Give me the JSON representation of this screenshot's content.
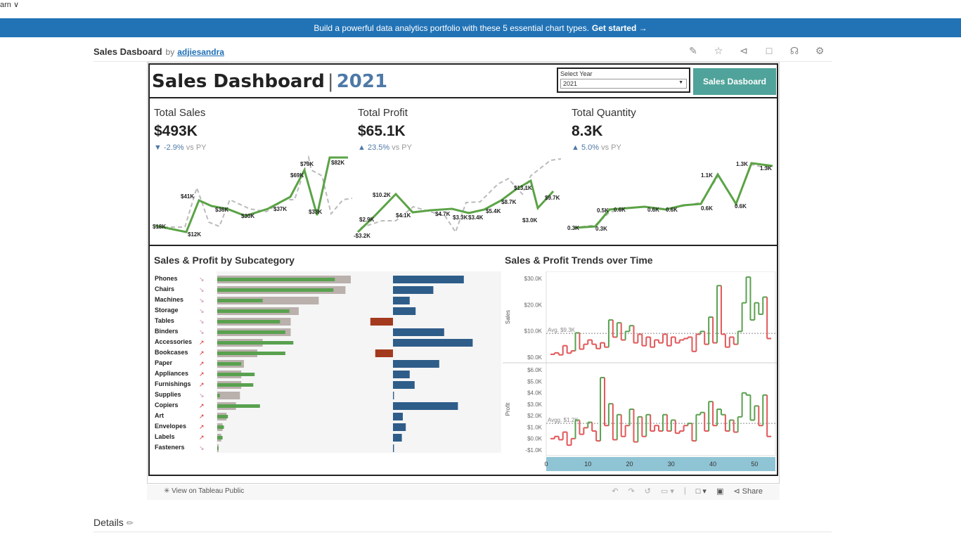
{
  "top": {
    "learn_label": "arn ∨"
  },
  "banner": {
    "text": "Build a powerful data analytics portfolio with these 5 essential chart types.",
    "cta": "Get started →"
  },
  "viz_header": {
    "title": "Sales Dasboard",
    "by": "by",
    "author": "adjiesandra",
    "icons": [
      "edit-icon",
      "star-icon",
      "share-icon",
      "comment-icon",
      "award-icon",
      "settings-icon"
    ]
  },
  "dashboard": {
    "title": "Sales Dashboard",
    "separator": "|",
    "year": "2021",
    "select_year_label": "Select Year",
    "select_year_value": "2021",
    "nav_button": "Sales Dasboard"
  },
  "kpis": [
    {
      "title": "Total Sales",
      "value": "$493K",
      "arrow": "▼",
      "delta": "-2.9%",
      "vs": "vs PY",
      "labels": [
        "$18K",
        "$12K",
        "$41K",
        "$36K",
        "$30K",
        "$37K",
        "$69K",
        "$33K",
        "$79K",
        "$82K"
      ]
    },
    {
      "title": "Total Profit",
      "value": "$65.1K",
      "arrow": "▲",
      "delta": "23.5%",
      "vs": "vs PY",
      "labels": [
        "$2.9K",
        "-$3.2K",
        "$10.2K",
        "$4.1K",
        "$4.7K",
        "$3.3K",
        "$3.4K",
        "$5.4K",
        "$8.7K",
        "$13.1K",
        "$3.0K",
        "$9.7K"
      ]
    },
    {
      "title": "Total Quantity",
      "value": "8.3K",
      "arrow": "▲",
      "delta": "5.0%",
      "vs": "vs PY",
      "labels": [
        "0.3K",
        "0.3K",
        "0.5K",
        "0.6K",
        "0.6K",
        "0.6K",
        "0.6K",
        "1.1K",
        "0.6K",
        "1.3K",
        "1.3K"
      ]
    }
  ],
  "subcategory": {
    "title": "Sales & Profit by Subcategory",
    "rows": [
      {
        "name": "Phones",
        "sales": 0.88,
        "sales_py": 1.0,
        "profit": 0.72,
        "trend": "down"
      },
      {
        "name": "Chairs",
        "sales": 0.87,
        "sales_py": 0.96,
        "profit": 0.41,
        "trend": "down"
      },
      {
        "name": "Machines",
        "sales": 0.34,
        "sales_py": 0.76,
        "profit": 0.17,
        "trend": "down"
      },
      {
        "name": "Storage",
        "sales": 0.54,
        "sales_py": 0.61,
        "profit": 0.23,
        "trend": "down"
      },
      {
        "name": "Tables",
        "sales": 0.47,
        "sales_py": 0.55,
        "profit": -0.23,
        "trend": "down"
      },
      {
        "name": "Binders",
        "sales": 0.51,
        "sales_py": 0.55,
        "profit": 0.52,
        "trend": "down"
      },
      {
        "name": "Accessories",
        "sales": 0.57,
        "sales_py": 0.34,
        "profit": 0.81,
        "trend": "up"
      },
      {
        "name": "Bookcases",
        "sales": 0.51,
        "sales_py": 0.3,
        "profit": -0.18,
        "trend": "up"
      },
      {
        "name": "Paper",
        "sales": 0.18,
        "sales_py": 0.2,
        "profit": 0.47,
        "trend": "up"
      },
      {
        "name": "Appliances",
        "sales": 0.28,
        "sales_py": 0.18,
        "profit": 0.17,
        "trend": "up"
      },
      {
        "name": "Furnishings",
        "sales": 0.27,
        "sales_py": 0.18,
        "profit": 0.22,
        "trend": "up"
      },
      {
        "name": "Supplies",
        "sales": 0.02,
        "sales_py": 0.17,
        "profit": 0.01,
        "trend": "down"
      },
      {
        "name": "Copiers",
        "sales": 0.32,
        "sales_py": 0.14,
        "profit": 0.66,
        "trend": "up"
      },
      {
        "name": "Art",
        "sales": 0.08,
        "sales_py": 0.07,
        "profit": 0.1,
        "trend": "up"
      },
      {
        "name": "Envelopes",
        "sales": 0.05,
        "sales_py": 0.04,
        "profit": 0.13,
        "trend": "up"
      },
      {
        "name": "Labels",
        "sales": 0.04,
        "sales_py": 0.03,
        "profit": 0.09,
        "trend": "up"
      },
      {
        "name": "Fasteners",
        "sales": 0.01,
        "sales_py": 0.01,
        "profit": 0.01,
        "trend": "down"
      }
    ]
  },
  "trends": {
    "title": "Sales & Profit Trends over Time",
    "sales_axis_title": "Sales",
    "profit_axis_title": "Profit",
    "sales_ticks": [
      "$30.0K",
      "$20.0K",
      "$10.0K",
      "$0.0K"
    ],
    "profit_ticks": [
      "$6.0K",
      "$5.0K",
      "$4.0K",
      "$3.0K",
      "$2.0K",
      "$1.0K",
      "$0.0K",
      "-$1.0K"
    ],
    "x_ticks": [
      "0",
      "10",
      "20",
      "30",
      "40",
      "50"
    ],
    "sales_avg_label": "Avg. $9.3K",
    "profit_avg_label": "Avgg. $1.2K"
  },
  "chart_data": {
    "type": "line",
    "title": "Sales & Profit Trends over Time",
    "xlabel": "",
    "ylabel": "Sales",
    "x": [
      1,
      2,
      3,
      4,
      5,
      6,
      7,
      8,
      9,
      10,
      11,
      12,
      13,
      14,
      15,
      16,
      17,
      18,
      19,
      20,
      21,
      22,
      23,
      24,
      25,
      26,
      27,
      28,
      29,
      30,
      31,
      32,
      33,
      34,
      35,
      36,
      37,
      38,
      39,
      40,
      41,
      42,
      43,
      44,
      45,
      46,
      47,
      48,
      49,
      50,
      51,
      52,
      53
    ],
    "series": [
      {
        "name": "Sales",
        "values": [
          2.0,
          2.5,
          1.8,
          5.0,
          2.4,
          3.2,
          9.5,
          3.8,
          5.5,
          7.0,
          5.5,
          4.0,
          6.0,
          4.5,
          14.0,
          8.0,
          13.0,
          7.0,
          10.0,
          12.0,
          6.0,
          9.0,
          5.0,
          8.0,
          4.5,
          7.0,
          6.0,
          9.0,
          5.0,
          8.0,
          6.0,
          7.0,
          7.5,
          8.0,
          3.0,
          9.0,
          10.0,
          5.5,
          15.0,
          6.0,
          26.0,
          9.0,
          4.5,
          8.0,
          5.5,
          10.0,
          20.0,
          29.0,
          14.0,
          20.0,
          16.0,
          22.0,
          7.5
        ]
      },
      {
        "name": "Profit",
        "values": [
          -0.2,
          0.0,
          -0.3,
          0.4,
          -0.8,
          -0.2,
          1.5,
          0.2,
          0.8,
          1.3,
          0.5,
          -0.4,
          5.4,
          1.0,
          3.0,
          -0.3,
          2.0,
          0.0,
          1.0,
          2.5,
          -0.5,
          1.8,
          0.0,
          2.0,
          0.5,
          1.0,
          0.5,
          2.0,
          0.5,
          1.5,
          0.3,
          0.5,
          1.0,
          1.2,
          -0.4,
          2.0,
          2.2,
          0.5,
          3.2,
          1.0,
          2.5,
          2.0,
          0.5,
          1.5,
          0.4,
          1.8,
          4.0,
          3.8,
          1.5,
          2.8,
          1.0,
          3.8,
          0.0
        ]
      }
    ],
    "sales_avg": 9.3,
    "profit_avg": 1.2,
    "ylim_sales": [
      0,
      30
    ],
    "ylim_profit": [
      -1.5,
      6.5
    ],
    "xlim": [
      0,
      55
    ]
  },
  "footer": {
    "view_on": "View on Tableau Public",
    "share": "Share"
  },
  "details": {
    "label": "Details"
  }
}
